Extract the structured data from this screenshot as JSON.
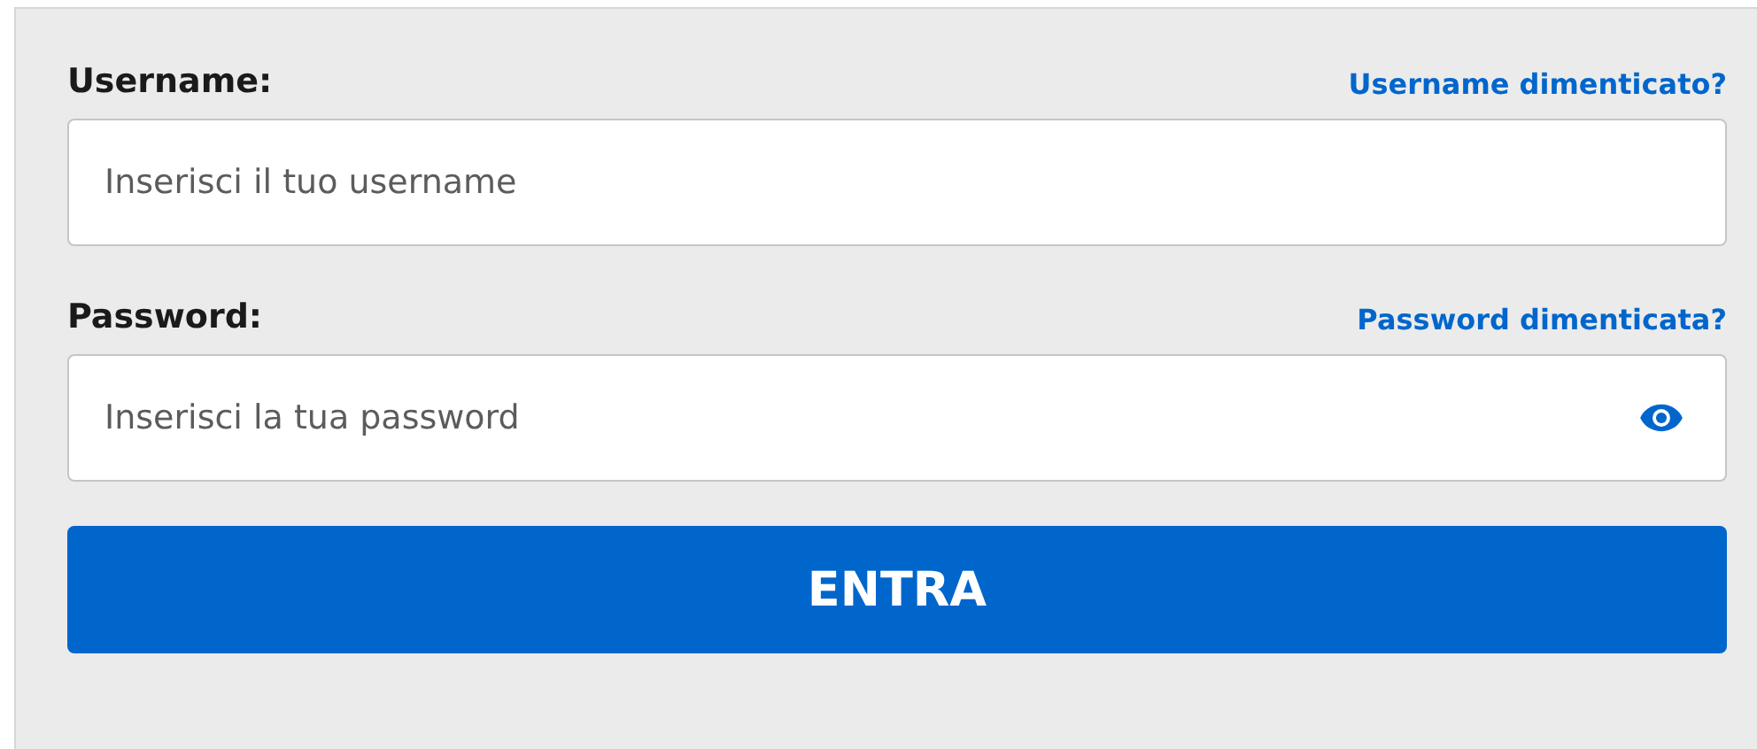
{
  "fields": [
    {
      "kind": "text",
      "label": "Username:",
      "link": "Username dimenticato?",
      "placeholder": "Inserisci il tuo username"
    },
    {
      "kind": "password",
      "label": "Password:",
      "link": "Password dimenticata?",
      "placeholder": "Inserisci la tua password"
    }
  ],
  "submit": {
    "label": "ENTRA"
  }
}
